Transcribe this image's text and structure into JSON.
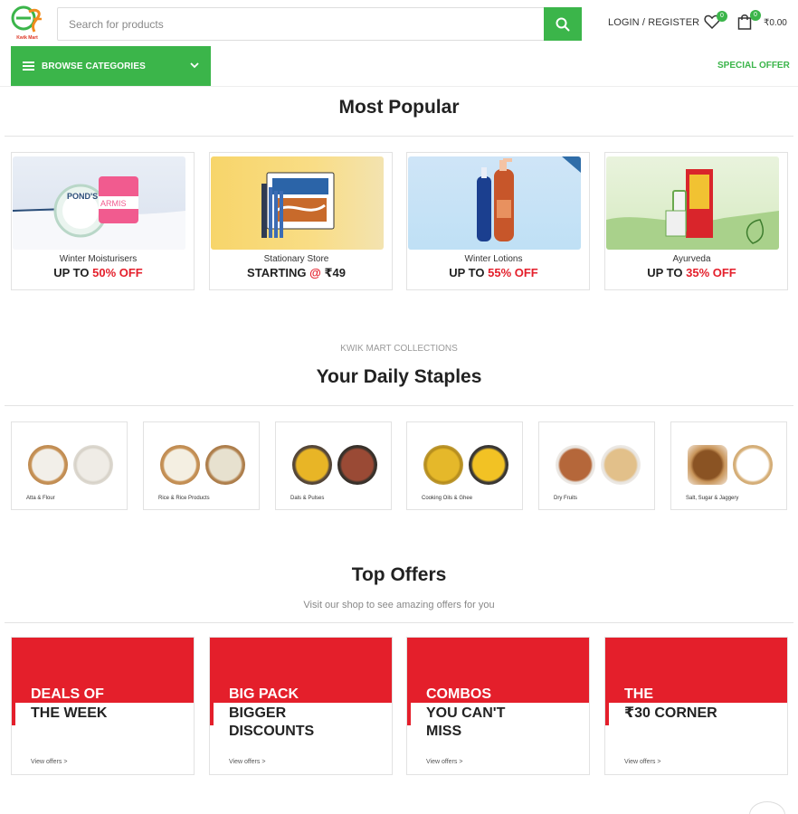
{
  "header": {
    "logo_text": "Kwik Mart",
    "search_placeholder": "Search for products",
    "login_label": "LOGIN / REGISTER",
    "wishlist_count": "0",
    "cart_count": "0",
    "cart_total": "₹0.00"
  },
  "nav": {
    "browse_label": "BROWSE CATEGORIES",
    "special_offer": "SPECIAL OFFER"
  },
  "popular": {
    "title": "Most Popular",
    "cards": [
      {
        "name": "Winter Moisturisers",
        "prefix": "UP TO ",
        "highlight": "50% OFF",
        "suffix": ""
      },
      {
        "name": "Stationary Store",
        "prefix": "STARTING ",
        "highlight": "@ ",
        "suffix": "₹49"
      },
      {
        "name": "Winter Lotions",
        "prefix": "UP TO ",
        "highlight": "55% OFF",
        "suffix": ""
      },
      {
        "name": "Ayurveda",
        "prefix": "UP TO ",
        "highlight": "35% OFF",
        "suffix": ""
      }
    ],
    "image_labels": [
      "POND'S",
      "ARMIS"
    ]
  },
  "staples": {
    "eyebrow": "KWIK MART COLLECTIONS",
    "title": "Your Daily Staples",
    "items": [
      {
        "label": "Atta & Flour"
      },
      {
        "label": "Rice & Rice Products"
      },
      {
        "label": "Dals & Pulses"
      },
      {
        "label": "Cooking Oils & Ghee"
      },
      {
        "label": "Dry Fruits"
      },
      {
        "label": "Salt, Sugar & Jaggery"
      }
    ]
  },
  "offers": {
    "title": "Top Offers",
    "subtitle": "Visit our shop to see amazing offers for you",
    "cards": [
      {
        "line1": "DEALS OF",
        "line2": "THE WEEK",
        "link": "View offers >"
      },
      {
        "line1": "BIG PACK",
        "line2": "BIGGER DISCOUNTS",
        "link": "View offers >"
      },
      {
        "line1": "COMBOS",
        "line2": "YOU CAN'T MISS",
        "link": "View offers >"
      },
      {
        "line1": "THE",
        "line2": "₹30 CORNER",
        "link": "View offers >"
      }
    ]
  },
  "colors": {
    "brand_green": "#3bb54a",
    "offer_red": "#e41f2b"
  }
}
